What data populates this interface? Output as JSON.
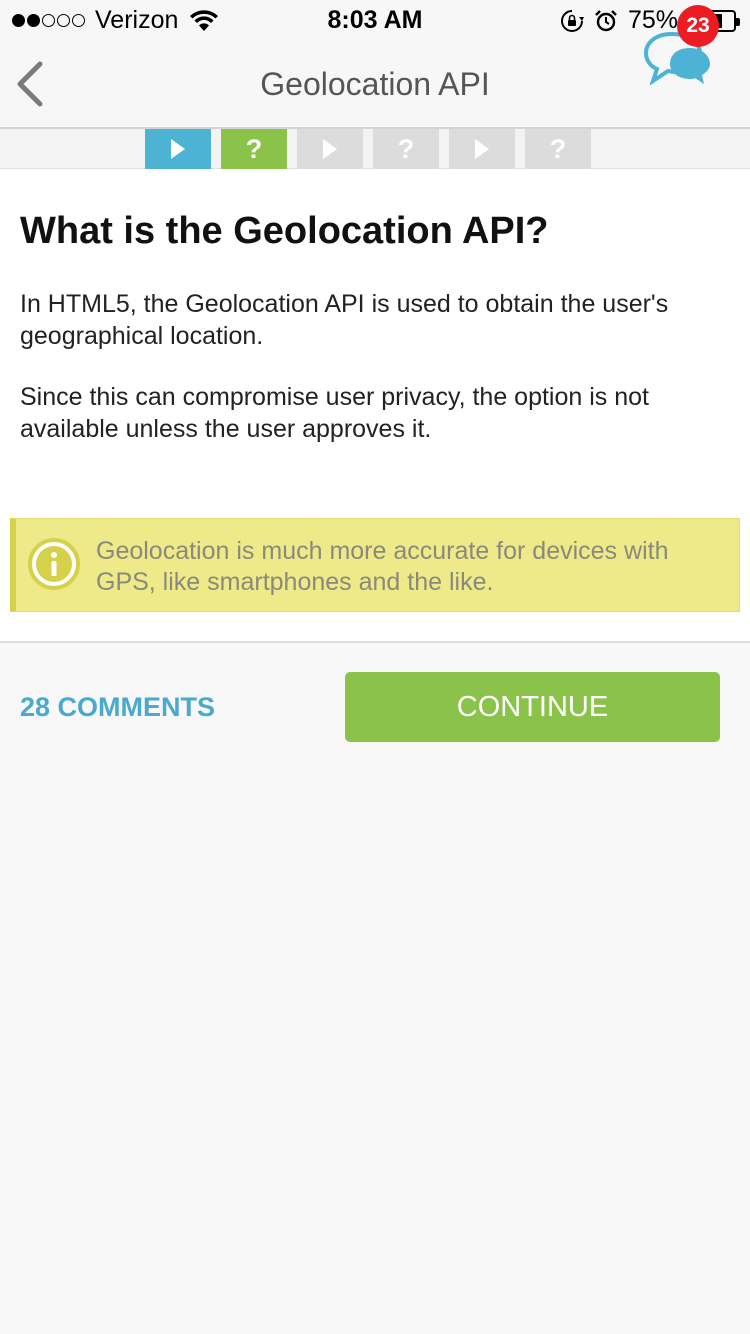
{
  "status_bar": {
    "signal_dots_filled": 2,
    "signal_dots_total": 5,
    "carrier": "Verizon",
    "time": "8:03 AM",
    "battery_percent": "75%",
    "battery_level": 0.75,
    "icons": [
      "wifi-icon",
      "rotation-lock-icon",
      "alarm-icon",
      "battery-icon"
    ]
  },
  "nav": {
    "back_icon": "chevron-left-icon",
    "title": "Geolocation API",
    "chat_icon": "chat-bubbles-icon",
    "chat_badge": "23"
  },
  "progress": {
    "steps": [
      {
        "type": "play",
        "color": "#4db3d4"
      },
      {
        "type": "question",
        "label": "?",
        "color": "#8bc34a"
      },
      {
        "type": "play",
        "color": "#dcdcdc"
      },
      {
        "type": "question",
        "label": "?",
        "color": "#dcdcdc"
      },
      {
        "type": "play",
        "color": "#dcdcdc"
      },
      {
        "type": "question",
        "label": "?",
        "color": "#dcdcdc"
      }
    ]
  },
  "lesson": {
    "title": "What is the Geolocation API?",
    "paragraph_1": "In HTML5, the Geolocation API is used to obtain the user's geographical location.",
    "paragraph_2": "Since this can compromise user privacy, the option is not available unless the user approves it.",
    "note_icon": "info-icon",
    "note": "Geolocation is much more accurate for devices with GPS, like smartphones and the like."
  },
  "footer": {
    "comments_label": "28 COMMENTS",
    "continue_label": "CONTINUE"
  },
  "colors": {
    "accent_blue": "#4aa9cc",
    "accent_green": "#8bc34a",
    "badge_red": "#ec1c24",
    "note_background": "#eeea8a"
  }
}
